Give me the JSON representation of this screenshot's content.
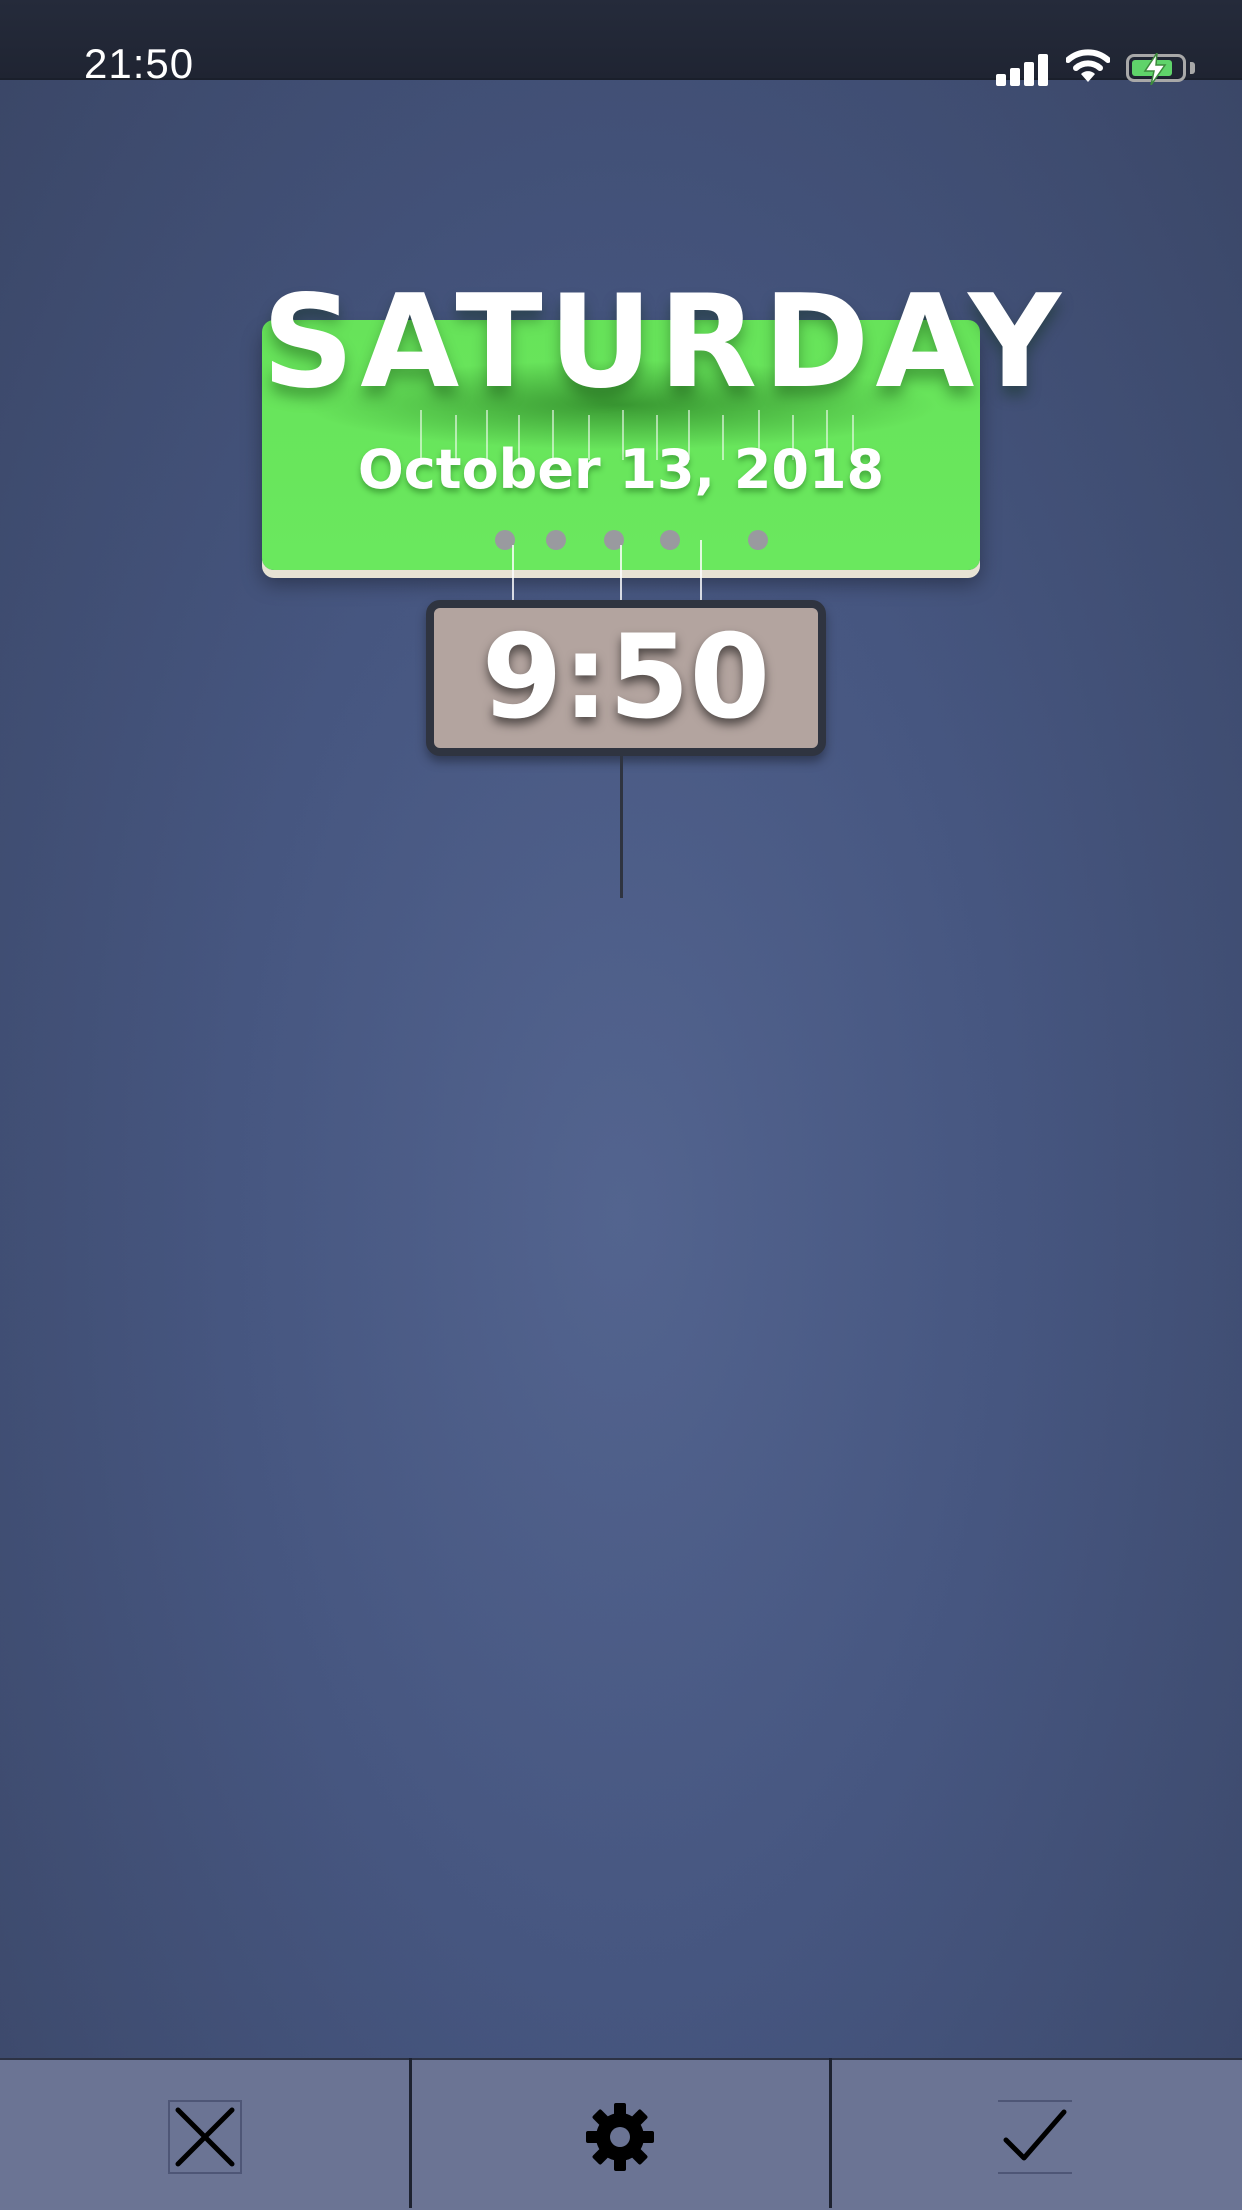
{
  "status_bar": {
    "time": "21:50",
    "icons": [
      "cellular-signal-icon",
      "wifi-icon",
      "battery-charging-icon"
    ],
    "battery_color": "#5fd36a"
  },
  "widget": {
    "day": "SATURDAY",
    "date": "October 13, 2018",
    "time": "9:50",
    "sign_color": "#67e35a",
    "clock_color": "#b3a49f"
  },
  "toolbar": {
    "buttons": [
      {
        "name": "close-button",
        "icon": "close-icon"
      },
      {
        "name": "settings-button",
        "icon": "gear-icon"
      },
      {
        "name": "confirm-button",
        "icon": "checkmark-icon"
      }
    ]
  }
}
